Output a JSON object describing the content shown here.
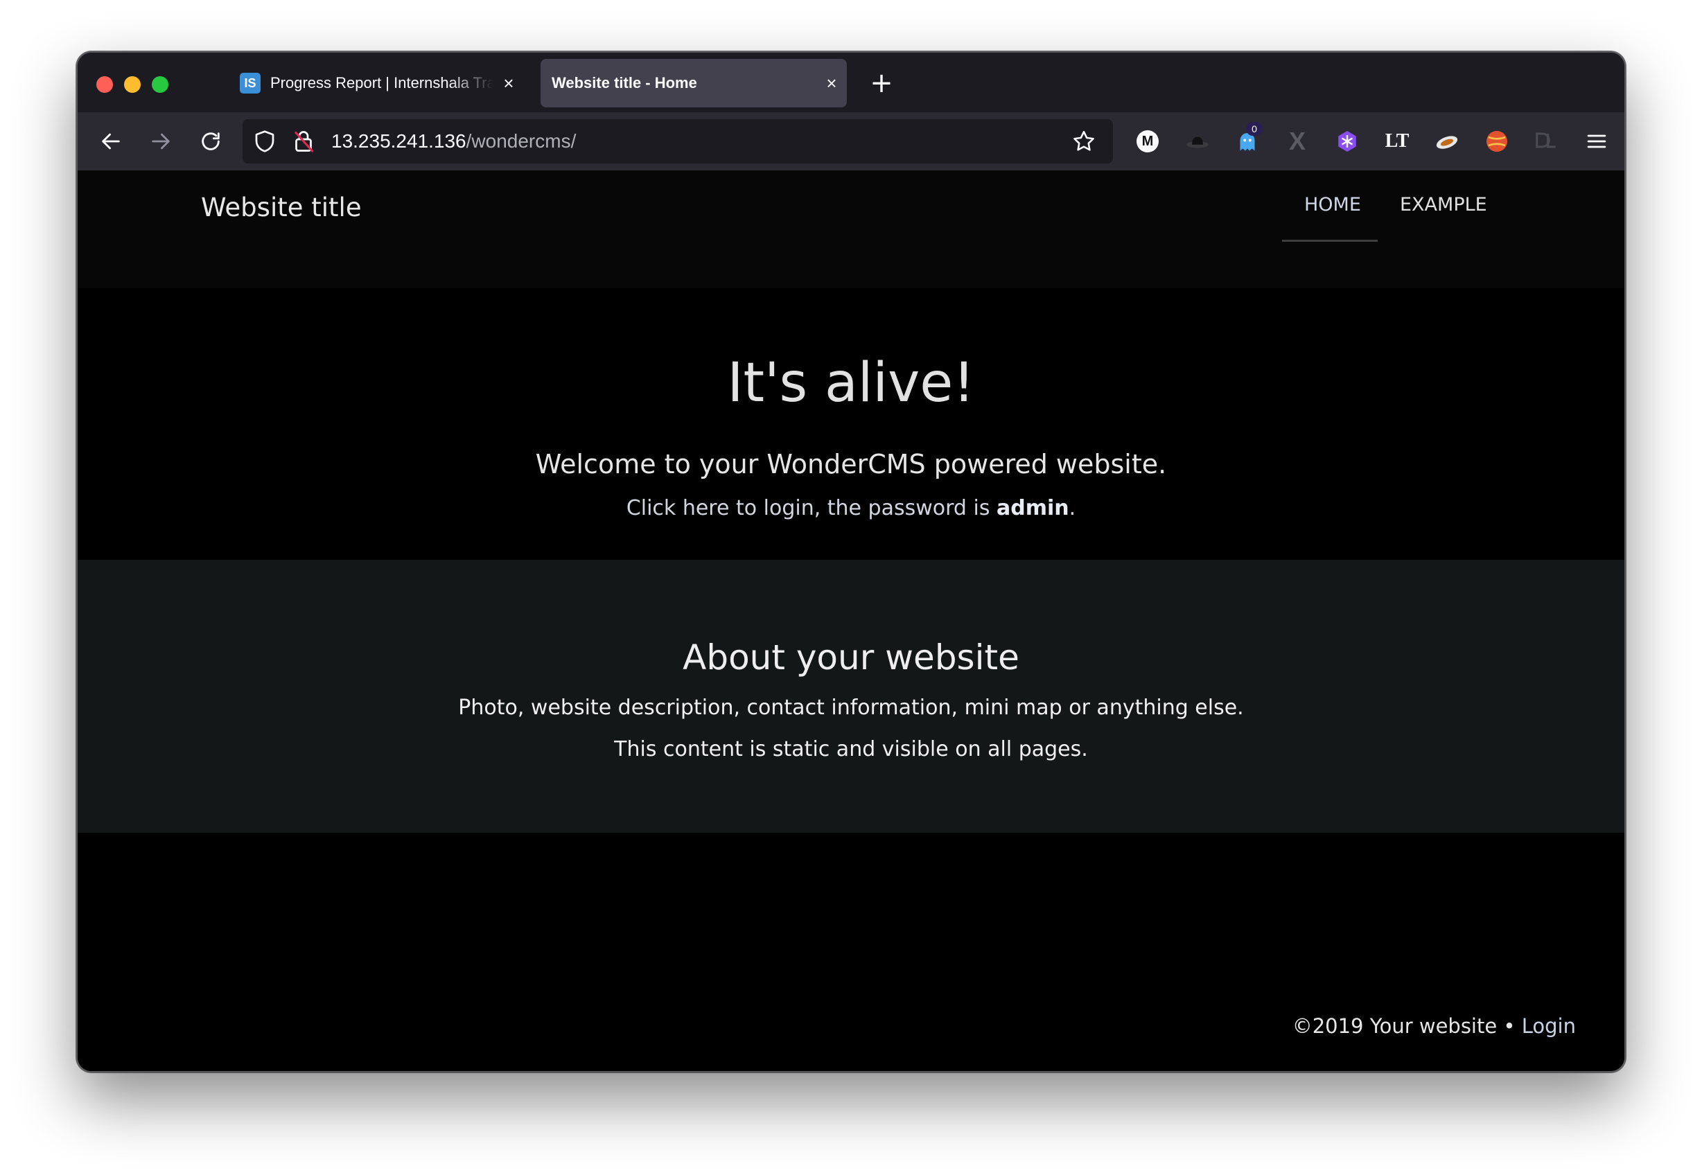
{
  "browser": {
    "tabs": [
      {
        "title": "Progress Report | Internshala Trainings",
        "favicon": "IS",
        "active": false,
        "close": "×"
      },
      {
        "title": "Website title - Home",
        "active": true,
        "close": "×"
      }
    ],
    "new_tab": "+",
    "url": {
      "host": "13.235.241.136",
      "path": "/wondercms/"
    },
    "toolbar_icons": [
      "back-icon",
      "forward-icon",
      "reload-icon",
      "shield-icon",
      "insecure-lock-icon",
      "bookmark-star-icon"
    ],
    "extensions": [
      {
        "name": "m-extension-icon",
        "label": "M"
      },
      {
        "name": "hat-extension-icon"
      },
      {
        "name": "ghost-extension-icon",
        "badge": "0"
      },
      {
        "name": "x-extension-icon",
        "label": "X"
      },
      {
        "name": "snowflake-extension-icon"
      },
      {
        "name": "lt-extension-icon",
        "label": "LT"
      },
      {
        "name": "fox-extension-icon"
      },
      {
        "name": "ball-extension-icon"
      },
      {
        "name": "dl-extension-icon"
      },
      {
        "name": "menu-icon"
      }
    ]
  },
  "site": {
    "title": "Website title",
    "nav": [
      "HOME",
      "EXAMPLE"
    ],
    "hero": {
      "heading": "It's alive!",
      "subheading": "Welcome to your WonderCMS powered website.",
      "login_prefix": "Click here to login, the password is ",
      "password": "admin",
      "login_suffix": "."
    },
    "about": {
      "heading": "About your website",
      "line1": "Photo, website description, contact information, mini map or anything else.",
      "line2": "This content is static and visible on all pages."
    },
    "footer": {
      "copyright": "©2019 Your website",
      "separator": " • ",
      "login": "Login"
    }
  },
  "colors": {
    "tabstrip": "#1c1b22",
    "toolbar": "#2b2a33",
    "active_tab": "#42414d",
    "page_bg": "#000000",
    "about_bg": "#141717"
  }
}
